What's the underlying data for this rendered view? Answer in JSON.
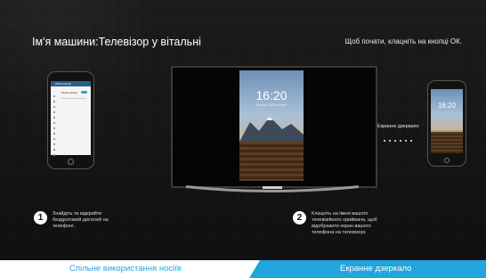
{
  "header": {
    "device_name": "Ім'я машини:Телевізор у вітальні",
    "start_hint": "Щоб почати, клацніть на кнопці ОК."
  },
  "tv": {
    "time": "16:20",
    "date": "Sunday, 28 December"
  },
  "phone_right": {
    "time": "16:20"
  },
  "phone_left": {
    "title": "Wireless display",
    "row": "Wireless display"
  },
  "mirror_label": "Екранне дзеркало",
  "steps": [
    {
      "number": "1",
      "text": "Знайдіть та відкрийте\nбездротовий дисплей на\nтелефоні."
    },
    {
      "number": "2",
      "text": "Клацніть на імені вашого\nтелевізійного приймача, щоб\nвідобразити екран вашого\nтелефона на телевізорі."
    }
  ],
  "tabs": {
    "media_sharing": "Спільне використання носіїв",
    "screen_mirroring": "Екранне дзеркало"
  },
  "colors": {
    "accent": "#22a4dd",
    "background": "#141414"
  }
}
